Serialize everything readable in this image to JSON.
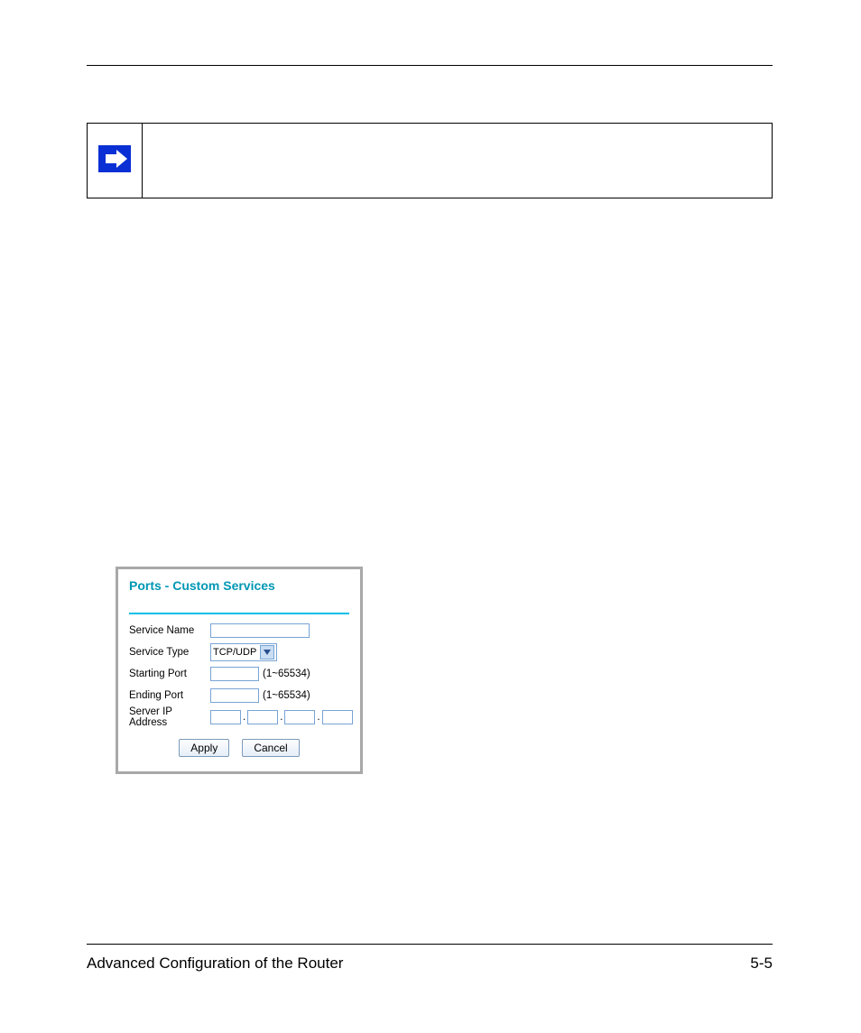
{
  "dialog": {
    "title": "Ports - Custom Services",
    "fields": {
      "service_name": {
        "label": "Service Name",
        "value": ""
      },
      "service_type": {
        "label": "Service Type",
        "selected": "TCP/UDP"
      },
      "starting_port": {
        "label": "Starting Port",
        "value": "",
        "hint": "(1~65534)"
      },
      "ending_port": {
        "label": "Ending Port",
        "value": "",
        "hint": "(1~65534)"
      },
      "server_ip": {
        "label": "Server IP Address",
        "oct1": "",
        "oct2": "",
        "oct3": "",
        "oct4": ""
      }
    },
    "buttons": {
      "apply": "Apply",
      "cancel": "Cancel"
    }
  },
  "footer": {
    "left": "Advanced Configuration of the Router",
    "right": "5-5"
  }
}
